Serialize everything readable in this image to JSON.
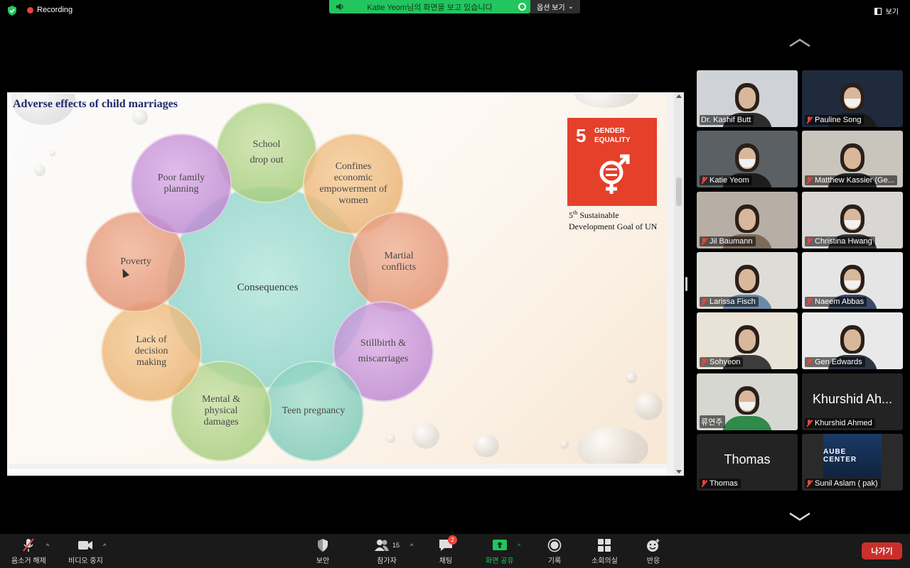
{
  "topbar": {
    "recording_label": "Recording",
    "share_banner_text": "Katie Yeom님의 화면을 보고 있습니다",
    "options_label": "옵션 보기",
    "view_label": "보기"
  },
  "slide": {
    "title": "Adverse effects of child marriages",
    "center_label": "Consequences",
    "petals": [
      "School\ndrop out",
      "Confines economic empowerment of women",
      "Martial conflicts",
      "Stillbirth & miscarriages",
      "Teen pregnancy",
      "Mental & physical damages",
      "Lack of decision making",
      "Poverty",
      "Poor family planning"
    ],
    "sdg": {
      "number": "5",
      "label_line1": "GENDER",
      "label_line2": "EQUALITY",
      "note_sup": "th",
      "note_prefix": "5",
      "note_line1": " Sustainable",
      "note_line2": "Development Goal of UN"
    }
  },
  "participants": [
    {
      "name": "Dr. Kashif Butt",
      "muted": false,
      "active": true,
      "bg": "#cfd2d6",
      "shirt": "#2c2c2c"
    },
    {
      "name": "Pauline Song",
      "muted": true,
      "active": false,
      "bg": "#1f2a3d",
      "shirt": "#1b1b1b"
    },
    {
      "name": "Katie Yeom",
      "muted": true,
      "active": false,
      "bg": "#5b6064",
      "shirt": "#1d1d1d"
    },
    {
      "name": "Matthew Kassier (Ge...",
      "muted": true,
      "active": false,
      "bg": "#c9c4bc",
      "shirt": "#2a2a2a"
    },
    {
      "name": "Jil Baumann",
      "muted": true,
      "active": false,
      "bg": "#b7aea5",
      "shirt": "#7d6a58"
    },
    {
      "name": "Christina Hwang",
      "muted": true,
      "active": false,
      "bg": "#d8d7d4",
      "shirt": "#3a3a3a"
    },
    {
      "name": "Larissa Fisch",
      "muted": true,
      "active": false,
      "bg": "#dedcd6",
      "shirt": "#6b8aa8"
    },
    {
      "name": "Naeem Abbas",
      "muted": true,
      "active": false,
      "bg": "#e5e5e5",
      "shirt": "#3b4a66"
    },
    {
      "name": "Sohyeon",
      "muted": true,
      "active": false,
      "bg": "#e9e2d7",
      "shirt": "#3c3c3c"
    },
    {
      "name": "Gen Edwards",
      "muted": true,
      "active": false,
      "bg": "#e9e9e9",
      "shirt": "#2e3440"
    },
    {
      "name": "류연주",
      "muted": false,
      "active": false,
      "bg": "#d7d7d2",
      "shirt": "#2f8a4c"
    },
    {
      "name": "Khurshid Ahmed",
      "muted": true,
      "active": false,
      "big_name": "Khurshid Ah...",
      "no_video": true
    },
    {
      "name": "Thomas",
      "muted": true,
      "active": false,
      "big_name": "Thomas",
      "no_video": true
    },
    {
      "name": "Sunil Aslam ( pak)",
      "muted": true,
      "active": false,
      "logo_text": "AUBE CENTER"
    }
  ],
  "toolbar": {
    "unmute": "음소거 해제",
    "stop_video": "비디오 중지",
    "security": "보안",
    "participants": "참가자",
    "participants_count": "15",
    "chat": "채팅",
    "chat_badge": "2",
    "share_screen": "화면 공유",
    "record": "기록",
    "breakout": "소회의실",
    "reactions": "반응",
    "leave": "나가기"
  }
}
